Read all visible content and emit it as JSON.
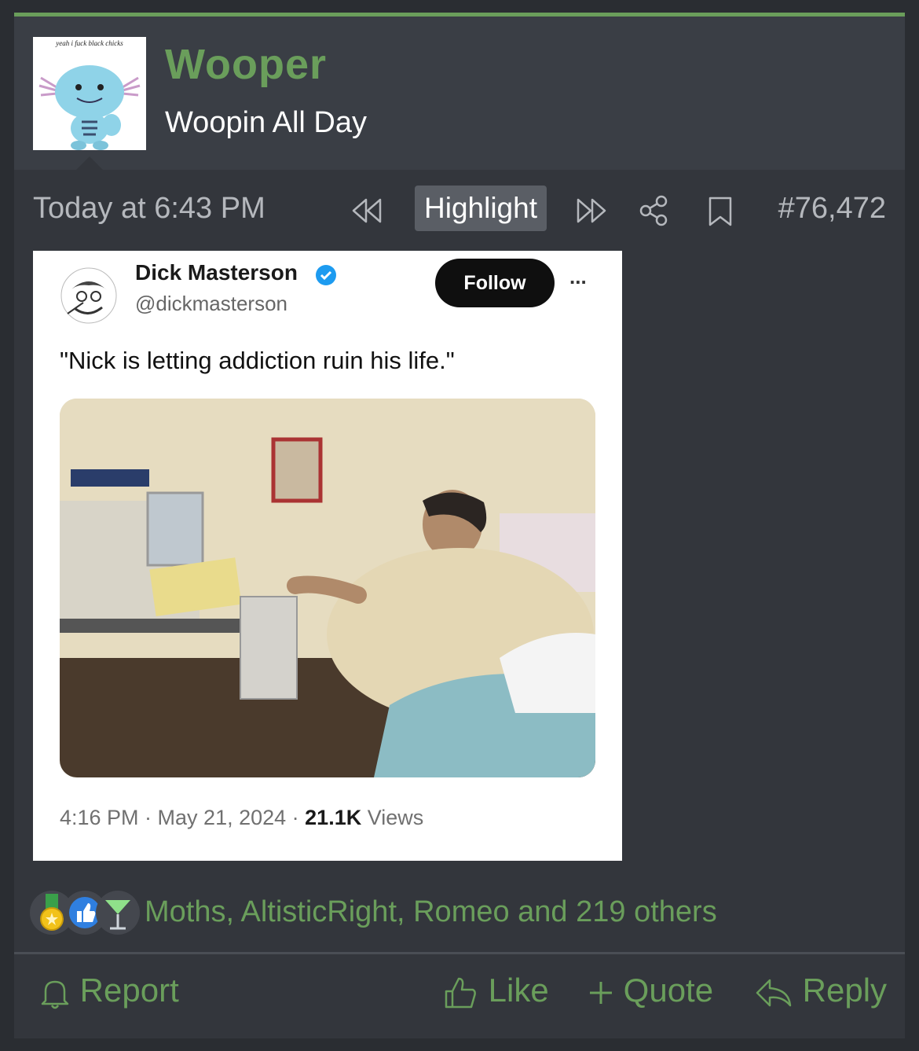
{
  "user": {
    "avatar_caption": "yeah i fuck black chicks",
    "name": "Wooper",
    "title": "Woopin All Day"
  },
  "meta": {
    "timestamp": "Today at 6:43 PM",
    "highlight_label": "Highlight",
    "post_number": "#76,472"
  },
  "embed": {
    "author_name": "Dick Masterson",
    "author_handle": "@dickmasterson",
    "follow_label": "Follow",
    "more_label": "...",
    "text": "\"Nick is letting addiction ruin his life.\"",
    "footer_time": "4:16 PM · May 21, 2024 · ",
    "footer_views_count": "21.1K",
    "footer_views_label": " Views"
  },
  "reactions": {
    "icons": [
      "medal-icon",
      "like-icon",
      "cocktail-icon"
    ],
    "text": "Moths, AltisticRight, Romeo and 219 others"
  },
  "actions": {
    "report": "Report",
    "like": "Like",
    "quote": "Quote",
    "reply": "Reply"
  },
  "colors": {
    "accent": "#6a9e5b",
    "post_bg": "#33363c",
    "header_bg": "#3a3e45"
  }
}
